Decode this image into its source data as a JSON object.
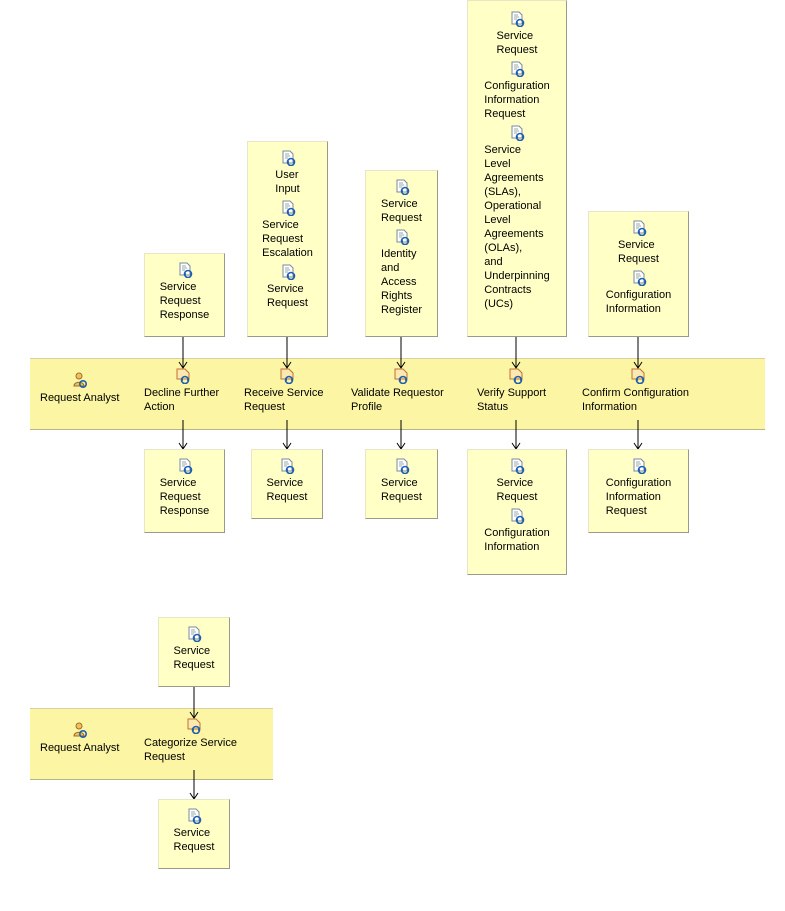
{
  "colors": {
    "lane": "#fcf6a4",
    "box": "#ffffc6"
  },
  "lanes": [
    {
      "role": "Request Analyst",
      "tasks": [
        {
          "label": "Decline Further\nAction",
          "inputs": [
            "Service\nRequest\nResponse"
          ],
          "outputs": [
            "Service\nRequest\nResponse"
          ]
        },
        {
          "label": "Receive Service\nRequest",
          "inputs": [
            "User\nInput",
            "Service\nRequest\nEscalation",
            "Service\nRequest"
          ],
          "outputs": [
            "Service\nRequest"
          ]
        },
        {
          "label": "Validate Requestor\nProfile",
          "inputs": [
            "Service\nRequest",
            "Identity\nand\nAccess\nRights\nRegister"
          ],
          "outputs": [
            "Service\nRequest"
          ]
        },
        {
          "label": "Verify Support\nStatus",
          "inputs": [
            "Service\nRequest",
            "Configuration\nInformation\nRequest",
            "Service\nLevel\nAgreements\n(SLAs),\nOperational\nLevel\nAgreements\n(OLAs),\nand\nUnderpinning\nContracts\n(UCs)"
          ],
          "outputs": [
            "Service\nRequest",
            "Configuration\nInformation"
          ]
        },
        {
          "label": "Confirm Configuration\nInformation",
          "inputs": [
            "Service\nRequest",
            "Configuration\nInformation"
          ],
          "outputs": [
            "Configuration\nInformation\nRequest"
          ]
        }
      ]
    },
    {
      "role": "Request Analyst",
      "tasks": [
        {
          "label": "Categorize Service\nRequest",
          "inputs": [
            "Service\nRequest"
          ],
          "outputs": [
            "Service\nRequest"
          ]
        }
      ]
    }
  ],
  "icons": {
    "role": "role-icon",
    "task": "task-icon",
    "artifact": "artifact-icon"
  }
}
